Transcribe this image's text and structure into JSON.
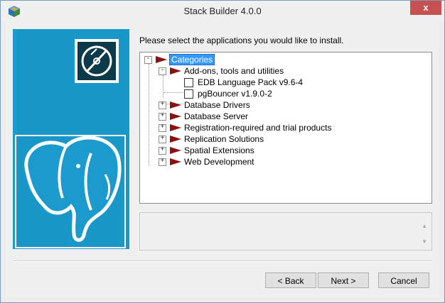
{
  "window": {
    "title": "Stack Builder 4.0.0",
    "close_glyph": "x"
  },
  "prompt": "Please select the applications you would like to install.",
  "tree": {
    "root": {
      "label": "Categories",
      "expander": "-"
    },
    "addons": {
      "label": "Add-ons, tools and utilities",
      "expander": "-",
      "children": [
        {
          "label": "EDB Language Pack v9.6-4",
          "checked": false
        },
        {
          "label": "pgBouncer v1.9.0-2",
          "checked": false
        }
      ]
    },
    "categories": [
      {
        "label": "Database Drivers",
        "expander": "+"
      },
      {
        "label": "Database Server",
        "expander": "+"
      },
      {
        "label": "Registration-required and trial products",
        "expander": "+"
      },
      {
        "label": "Replication Solutions",
        "expander": "+"
      },
      {
        "label": "Spatial Extensions",
        "expander": "+"
      },
      {
        "label": "Web Development",
        "expander": "+"
      }
    ]
  },
  "buttons": {
    "back": "< Back",
    "next": "Next >",
    "cancel": "Cancel"
  },
  "icons": {
    "app": "stack-builder-icon",
    "disc": "disc-icon",
    "elephant": "postgresql-elephant-logo",
    "arrow": "category-arrow-icon"
  },
  "colors": {
    "side_panel": "#1b9acd",
    "arrow": "#8b1010",
    "selection": "#3399ff",
    "close": "#c75050"
  }
}
